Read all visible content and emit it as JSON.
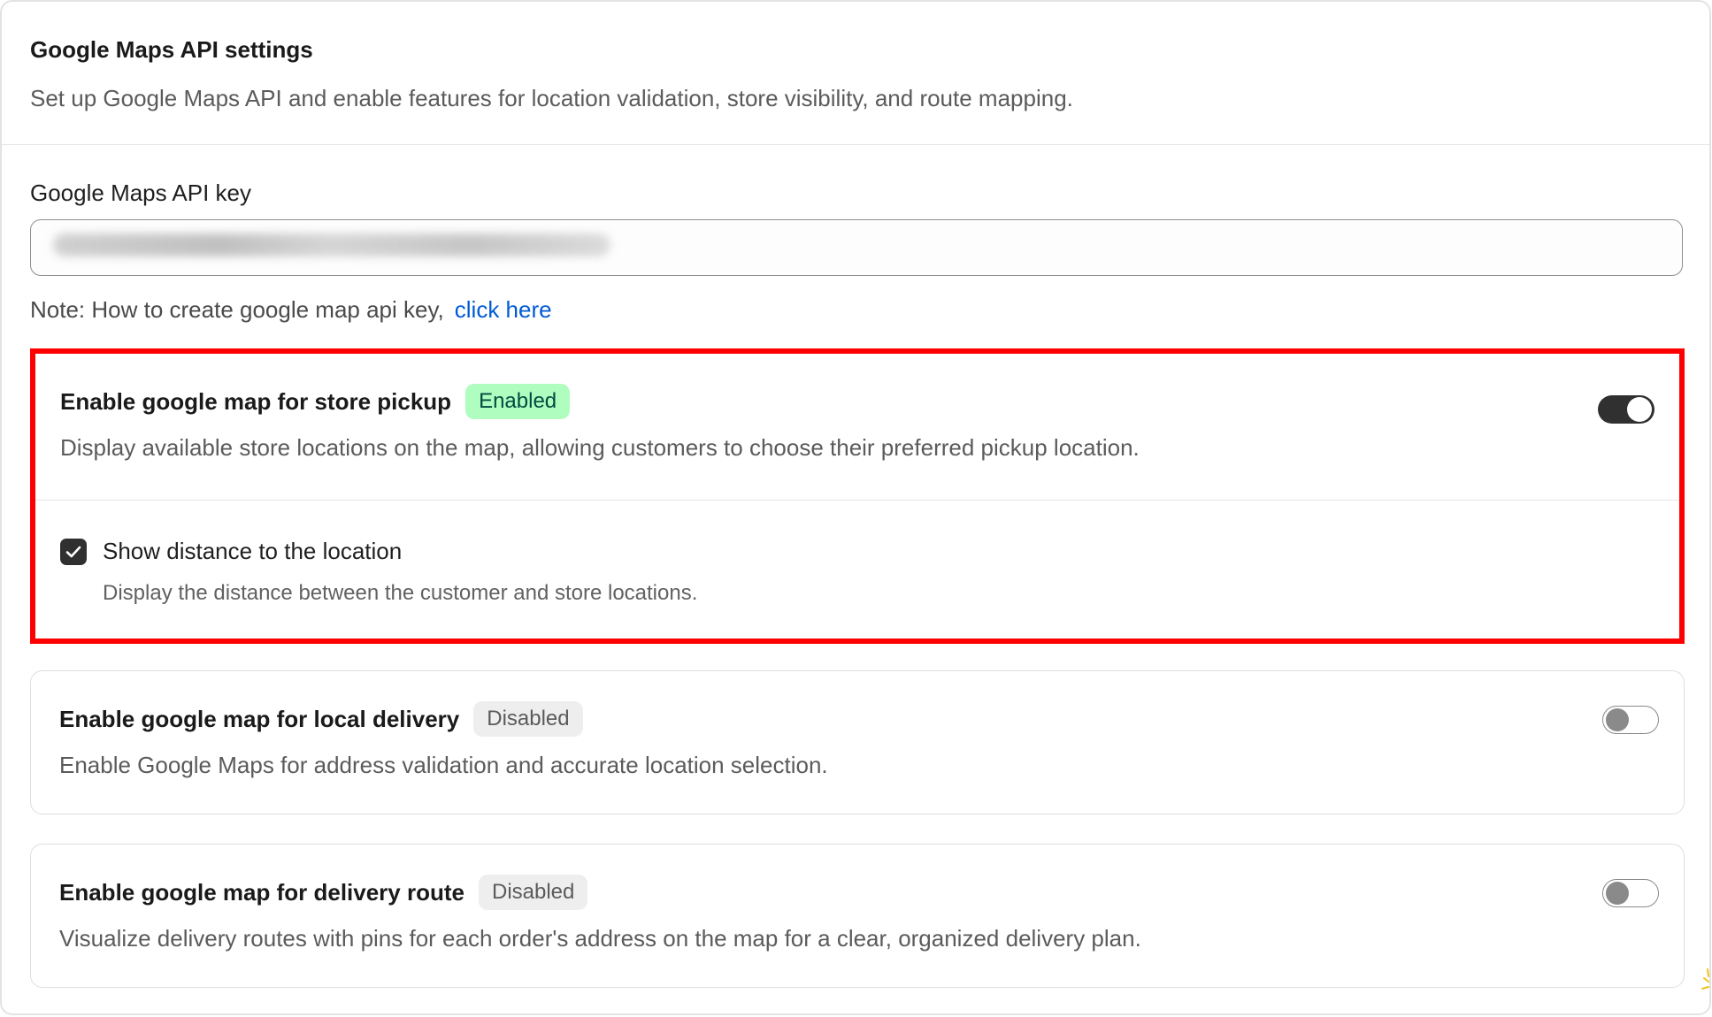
{
  "header": {
    "title": "Google Maps API settings",
    "subtitle": "Set up Google Maps API and enable features for location validation, store visibility, and route mapping."
  },
  "api_key": {
    "label": "Google Maps API key",
    "value": ""
  },
  "note": {
    "text": "Note: How to create google map api key,",
    "link": "click here"
  },
  "options": [
    {
      "title": "Enable google map for store pickup",
      "badge": "Enabled",
      "enabled": true,
      "description": "Display available store locations on the map, allowing customers to choose their preferred pickup location.",
      "sub_option": {
        "label": "Show distance to the location",
        "description": "Display the distance between the customer and store locations.",
        "checked": true
      }
    },
    {
      "title": "Enable google map for local delivery",
      "badge": "Disabled",
      "enabled": false,
      "description": "Enable Google Maps for address validation and accurate location selection."
    },
    {
      "title": "Enable google map for delivery route",
      "badge": "Disabled",
      "enabled": false,
      "description": "Visualize delivery routes with pins for each order's address on the map for a clear, organized delivery plan."
    }
  ],
  "colors": {
    "highlight_border": "#ff0000",
    "badge_enabled_bg": "#affebf",
    "badge_disabled_bg": "#eeeeee",
    "link": "#005bd3",
    "toggle_on": "#303030"
  },
  "icons": {
    "checkbox": "check-icon",
    "toggle": "toggle-switch"
  }
}
